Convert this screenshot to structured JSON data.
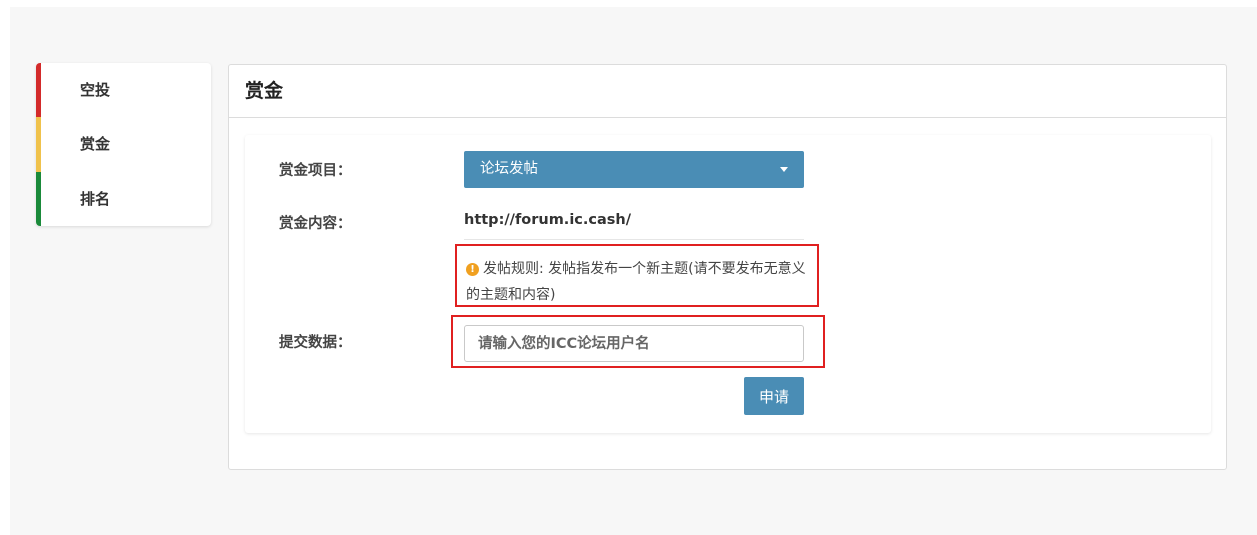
{
  "sidebar": {
    "items": [
      {
        "label": "空投",
        "accent": "#d32a2a"
      },
      {
        "label": "赏金",
        "accent": "#f0c24c"
      },
      {
        "label": "排名",
        "accent": "#1a8a3a"
      }
    ]
  },
  "panel": {
    "title": "赏金",
    "form": {
      "project_label": "赏金项目：",
      "project_value": "论坛发帖",
      "content_label": "赏金内容：",
      "content_value": "http://forum.ic.cash/",
      "rule_text": "发帖规则: 发帖指发布一个新主题(请不要发布无意义的主题和内容)",
      "submit_label": "提交数据：",
      "submit_placeholder": "请输入您的ICC论坛用户名",
      "apply_button": "申请"
    }
  },
  "colors": {
    "primary": "#4a8db5",
    "highlight_border": "#e02020",
    "info_icon": "#f0a020"
  }
}
